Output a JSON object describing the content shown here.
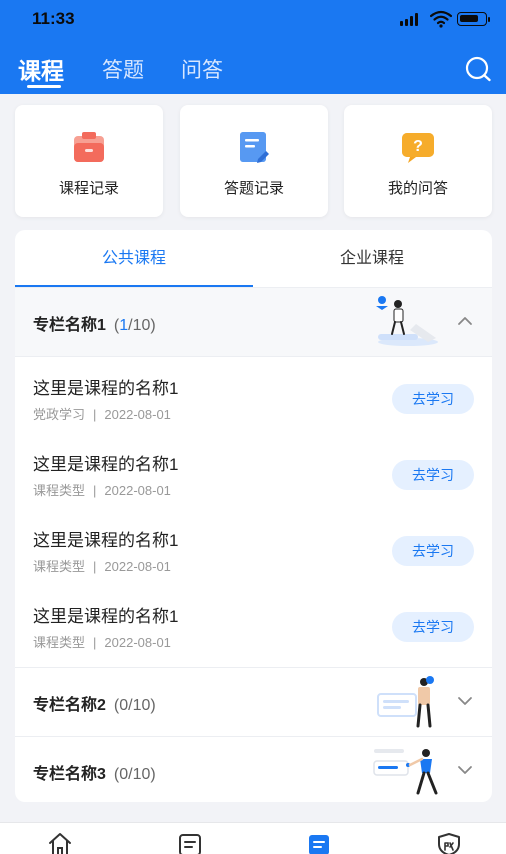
{
  "status": {
    "time": "11:33"
  },
  "header": {
    "tabs": [
      {
        "label": "课程",
        "active": true
      },
      {
        "label": "答题",
        "active": false
      },
      {
        "label": "问答",
        "active": false
      }
    ],
    "search_icon": "search-icon"
  },
  "quick_entries": [
    {
      "label": "课程记录",
      "icon": "clipboard-icon",
      "color": "#f36b5c"
    },
    {
      "label": "答题记录",
      "icon": "document-edit-icon",
      "color": "#4a90f0"
    },
    {
      "label": "我的问答",
      "icon": "question-bubble-icon",
      "color": "#f5a623"
    }
  ],
  "segments": [
    {
      "label": "公共课程",
      "active": true
    },
    {
      "label": "企业课程",
      "active": false
    }
  ],
  "columns": [
    {
      "name": "专栏名称1",
      "progress_open": "(",
      "progress_current": "1",
      "progress_rest": "/10)",
      "expanded": true,
      "courses": [
        {
          "title": "这里是课程的名称1",
          "type": "党政学习",
          "date": "2022-08-01",
          "action": "去学习"
        },
        {
          "title": "这里是课程的名称1",
          "type": "课程类型",
          "date": "2022-08-01",
          "action": "去学习"
        },
        {
          "title": "这里是课程的名称1",
          "type": "课程类型",
          "date": "2022-08-01",
          "action": "去学习"
        },
        {
          "title": "这里是课程的名称1",
          "type": "课程类型",
          "date": "2022-08-01",
          "action": "去学习"
        }
      ]
    },
    {
      "name": "专栏名称2",
      "progress_open": "(",
      "progress_current": "0",
      "progress_rest": "/10)",
      "expanded": false
    },
    {
      "name": "专栏名称3",
      "progress_open": "(",
      "progress_current": "0",
      "progress_rest": "/10)",
      "expanded": false
    }
  ],
  "separator": "|",
  "tabbar": [
    {
      "icon": "home-icon",
      "active": false
    },
    {
      "icon": "list-icon",
      "active": false
    },
    {
      "icon": "course-icon",
      "active": true
    },
    {
      "icon": "shield-icon",
      "active": false
    }
  ],
  "colors": {
    "primary": "#1a78f2",
    "background": "#f2f3f7",
    "button_bg": "#e5f0ff"
  }
}
